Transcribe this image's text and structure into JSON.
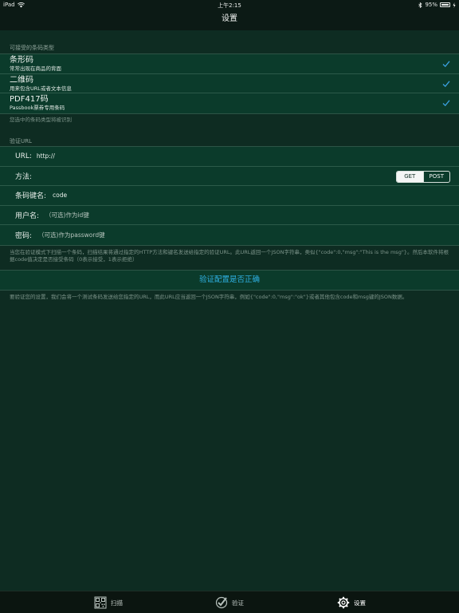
{
  "status_bar": {
    "device": "iPad",
    "time": "上午2:15",
    "battery_percent": "95%",
    "battery_level": 0.95
  },
  "nav": {
    "title": "设置"
  },
  "barcode_section": {
    "header": "可接受的条码类型",
    "items": [
      {
        "title": "条形码",
        "subtitle": "常常出现在商品的背面",
        "checked": true
      },
      {
        "title": "二维码",
        "subtitle": "用来包含URL或者文本信息",
        "checked": true
      },
      {
        "title": "PDF417码",
        "subtitle": "Passbook票券专用条码",
        "checked": true
      }
    ],
    "footer": "您选中的条码类型将被识别"
  },
  "url_section": {
    "header": "验证URL",
    "url": {
      "label": "URL:",
      "value": "http://"
    },
    "method": {
      "label": "方法:",
      "options": [
        "GET",
        "POST"
      ],
      "selected": "GET"
    },
    "key": {
      "label": "条码键名:",
      "value": "code"
    },
    "username": {
      "label": "用户名:",
      "placeholder": "（可选)作为id键"
    },
    "password": {
      "label": "密码:",
      "placeholder": "（可选)作为password键"
    },
    "footer": "当您在验证模式下扫描一个条码，扫描结果将通过指定的HTTP方法和键名发送给指定的验证URL。此URL返回一个JSON字符串，类似{\"code\":0,\"msg\":\"This is the msg\"}。然后本软件将根据code值决定是否接受条码（0表示接受，1表示拒绝）"
  },
  "verify": {
    "button_label": "验证配置是否正确",
    "footer": "要验证您的设置，我们会将一个测试条码发送给您指定的URL，而此URL应当返回一个JSON字符串，例如{\"code\":0,\"msg\":\"ok\"}或者其他包含code和msg键的JSON数据。"
  },
  "tabs": [
    {
      "label": "扫描",
      "icon": "qr-code-icon"
    },
    {
      "label": "验证",
      "icon": "verify-check-icon"
    },
    {
      "label": "设置",
      "icon": "gear-icon"
    }
  ],
  "colors": {
    "background": "#0e2c22",
    "cell": "#0b3b2b",
    "accent": "#2fb3e6",
    "check": "#3aa0df"
  }
}
